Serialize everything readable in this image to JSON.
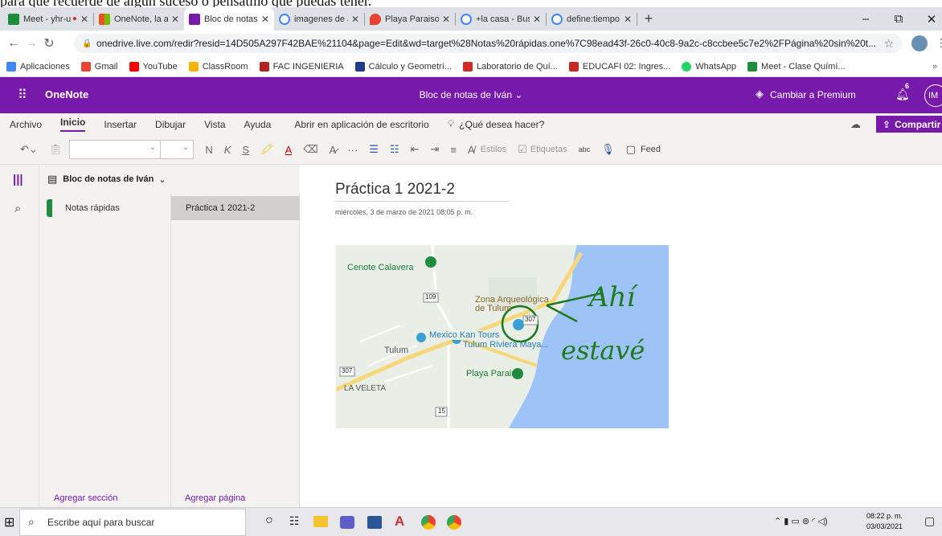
{
  "document_top_text": "para que recuerde de algún suceso o pensatmo que puedas tener.",
  "browser": {
    "tabs": [
      {
        "title": "Meet - yhr-ua",
        "color": "#1e8e3e"
      },
      {
        "title": "OneNote, la aplica",
        "color": "#f25022"
      },
      {
        "title": "Bloc de notas de I",
        "color": "#7719aa",
        "active": true
      },
      {
        "title": "imagenes de arbo",
        "color": "#4285f4"
      },
      {
        "title": "Playa Paraiso - Go",
        "color": "#ea4335"
      },
      {
        "title": "+la casa - Buscar c",
        "color": "#4285f4"
      },
      {
        "title": "define:tiempo - Bu",
        "color": "#4285f4"
      }
    ],
    "new_tab": "+",
    "window_controls": {
      "minimize": "–",
      "restore": "⧉",
      "close": "✕"
    },
    "url": "onedrive.live.com/redir?resid=14D505A297F42BAE%21104&page=Edit&wd=target%28Notas%20rápidas.one%7C98ead43f-26c0-40c8-9a2c-c8ccbee5c7e2%2FPágina%20sin%20t...",
    "bookmarks": [
      {
        "label": "Aplicaciones",
        "color": "#4285f4"
      },
      {
        "label": "Gmail",
        "color": "#ea4335"
      },
      {
        "label": "YouTube",
        "color": "#ff0000"
      },
      {
        "label": "ClassRoom",
        "color": "#f4b400"
      },
      {
        "label": "FAC INGENIERIA",
        "color": "#b22222"
      },
      {
        "label": "Cálculo y Geometrí...",
        "color": "#1a3e8c"
      },
      {
        "label": "Laboratorio de Quí...",
        "color": "#d02b2b"
      },
      {
        "label": "EDUCAFI 02: Ingres...",
        "color": "#c62828"
      },
      {
        "label": "WhatsApp",
        "color": "#25d366"
      },
      {
        "label": "Meet - Clase Químí...",
        "color": "#1e8e3e"
      }
    ]
  },
  "onenote": {
    "app_name": "OneNote",
    "notebook_title": "Bloc de notas de Iván ⌄",
    "premium": "Cambiar a Premium",
    "notif_count": "6",
    "avatar": "IM",
    "menu": [
      "Archivo",
      "Inicio",
      "Insertar",
      "Dibujar",
      "Vista",
      "Ayuda",
      "Abrir en aplicación de escritorio"
    ],
    "tell_me": "¿Qué desea hacer?",
    "share": "Compartir",
    "ribbon": {
      "bold": "N",
      "italic": "K",
      "underline": "S",
      "more": "···",
      "styles": "Estilos",
      "tags": "Etiquetas",
      "spell": "abc",
      "feed": "Feed"
    },
    "notebook_name": "Bloc de notas de Iván",
    "section": "Notas rápidas",
    "page": "Práctica 1 2021-2",
    "add_section": "Agregar sección",
    "add_page": "Agregar página",
    "page_title": "Práctica 1 2021-2",
    "page_date": "miércoles, 3 de marzo de 2021    08:05 p. m."
  },
  "map": {
    "labels": [
      "Cenote Calavera",
      "Zona Arqueológica de Tulum",
      "Mexico Kan Tours",
      "Tulum Riviera Maya...",
      "Tulum",
      "Playa Paraiso",
      "LA VELETA"
    ],
    "road_shields": [
      "109",
      "307",
      "307",
      "15"
    ],
    "handwriting": [
      "Ahí",
      "estavé"
    ],
    "colors": {
      "land": "#e9efe6",
      "water": "#9ec4f7",
      "road": "#f7d77a",
      "ink": "#1f7a1f"
    }
  },
  "taskbar": {
    "search_placeholder": "Escribe aquí para buscar",
    "time": "08:22 p. m.",
    "date": "03/03/2021"
  }
}
